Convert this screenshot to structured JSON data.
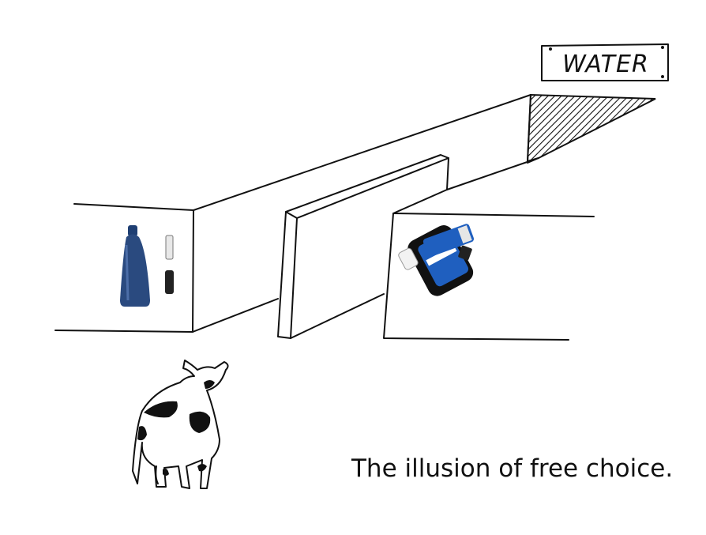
{
  "sign": {
    "text": "WATER"
  },
  "caption": {
    "text": "The illusion of free choice."
  },
  "colors": {
    "ink": "#111111",
    "bottle_blue": "#2a4a7f",
    "filter_blue": "#1f5fbf",
    "cow_spots": "#111111"
  },
  "icons": [
    "water-bottle-icon",
    "filter-stick-icon",
    "squeeze-filter-icon",
    "cow-icon"
  ]
}
